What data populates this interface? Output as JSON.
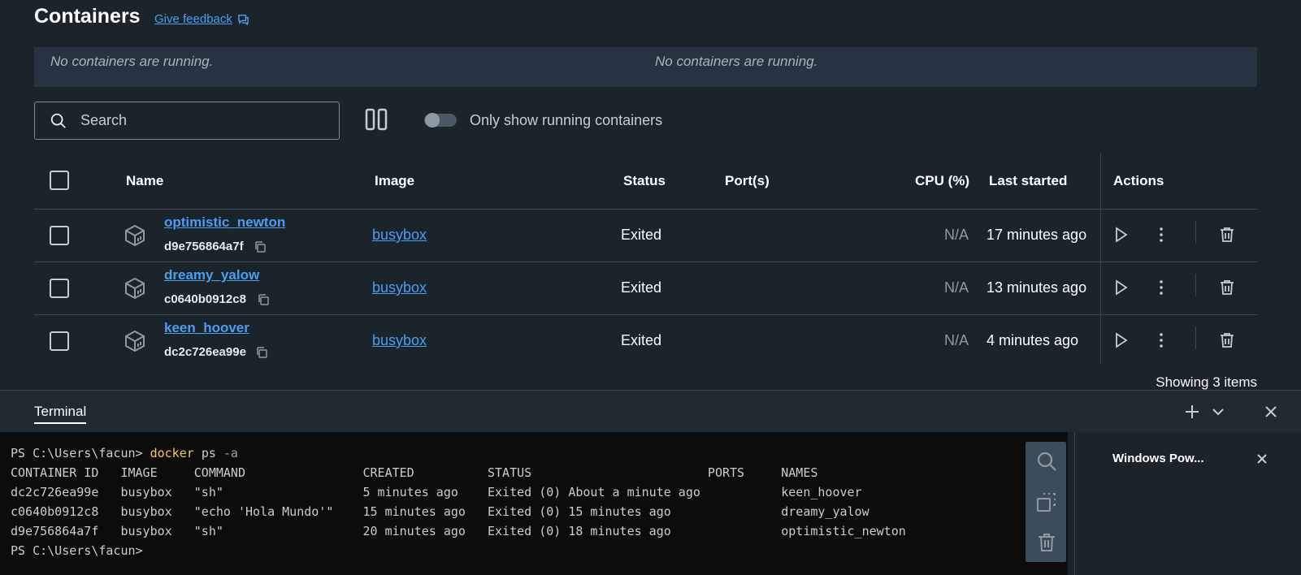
{
  "header": {
    "title": "Containers",
    "feedback_label": "Give feedback"
  },
  "banner": {
    "left_text": "No containers are running.",
    "right_text": "No containers are running."
  },
  "toolbar": {
    "search_placeholder": "Search",
    "toggle_label": "Only show running containers",
    "toggle_on": false
  },
  "table": {
    "headers": {
      "name": "Name",
      "image": "Image",
      "status": "Status",
      "ports": "Port(s)",
      "cpu": "CPU (%)",
      "last_started": "Last started",
      "actions": "Actions"
    },
    "rows": [
      {
        "name": "optimistic_newton",
        "id": "d9e756864a7f",
        "image": "busybox",
        "status": "Exited",
        "ports": "",
        "cpu": "N/A",
        "last_started": "17 minutes ago"
      },
      {
        "name": "dreamy_yalow",
        "id": "c0640b0912c8",
        "image": "busybox",
        "status": "Exited",
        "ports": "",
        "cpu": "N/A",
        "last_started": "13 minutes ago"
      },
      {
        "name": "keen_hoover",
        "id": "dc2c726ea99e",
        "image": "busybox",
        "status": "Exited",
        "ports": "",
        "cpu": "N/A",
        "last_started": "4 minutes ago"
      }
    ],
    "footer": "Showing 3 items"
  },
  "terminal": {
    "tab_label": "Terminal",
    "prompt": "PS C:\\Users\\facun>",
    "command": "docker",
    "args": "ps",
    "flag": "-a",
    "lines": [
      "CONTAINER ID   IMAGE     COMMAND                CREATED          STATUS                        PORTS     NAMES",
      "dc2c726ea99e   busybox   \"sh\"                   5 minutes ago    Exited (0) About a minute ago           keen_hoover",
      "c0640b0912c8   busybox   \"echo 'Hola Mundo'\"    15 minutes ago   Exited (0) 15 minutes ago               dreamy_yalow",
      "d9e756864a7f   busybox   \"sh\"                   20 minutes ago   Exited (0) 18 minutes ago               optimistic_newton"
    ],
    "final_prompt": "PS C:\\Users\\facun>",
    "side_panel_label": "Windows Pow..."
  },
  "colors": {
    "background": "#1b232b",
    "link": "#4a9ef0",
    "banner": "#263340",
    "terminal_bg": "#0c0c0c",
    "command": "#f9c74f"
  },
  "icons": [
    "feedback-icon",
    "search-icon",
    "columns-icon",
    "container-icon",
    "copy-icon",
    "play-icon",
    "more-vertical-icon",
    "trash-icon",
    "plus-icon",
    "chevron-down-icon",
    "close-icon",
    "terminal-search-icon",
    "terminal-select-icon",
    "terminal-clear-icon"
  ]
}
